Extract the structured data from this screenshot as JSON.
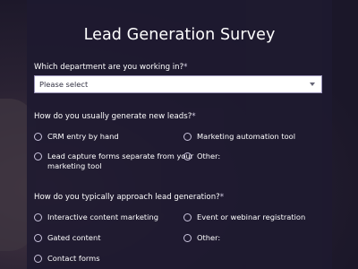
{
  "form": {
    "title": "Lead Generation Survey",
    "q1": {
      "label": "Which department are you working in?",
      "required": "*",
      "select_value": "Please select"
    },
    "q2": {
      "label": "How do you usually generate new leads?",
      "required": "*",
      "options": [
        "CRM entry by hand",
        "Marketing automation tool",
        "Lead capture forms separate from your\nmarketing tool",
        "Other:"
      ]
    },
    "q3": {
      "label": "How do you typically approach lead generation?",
      "required": "*",
      "options": [
        "Interactive content marketing",
        "Event or webinar registration",
        "Gated content",
        "Other:",
        "Contact forms"
      ]
    }
  }
}
